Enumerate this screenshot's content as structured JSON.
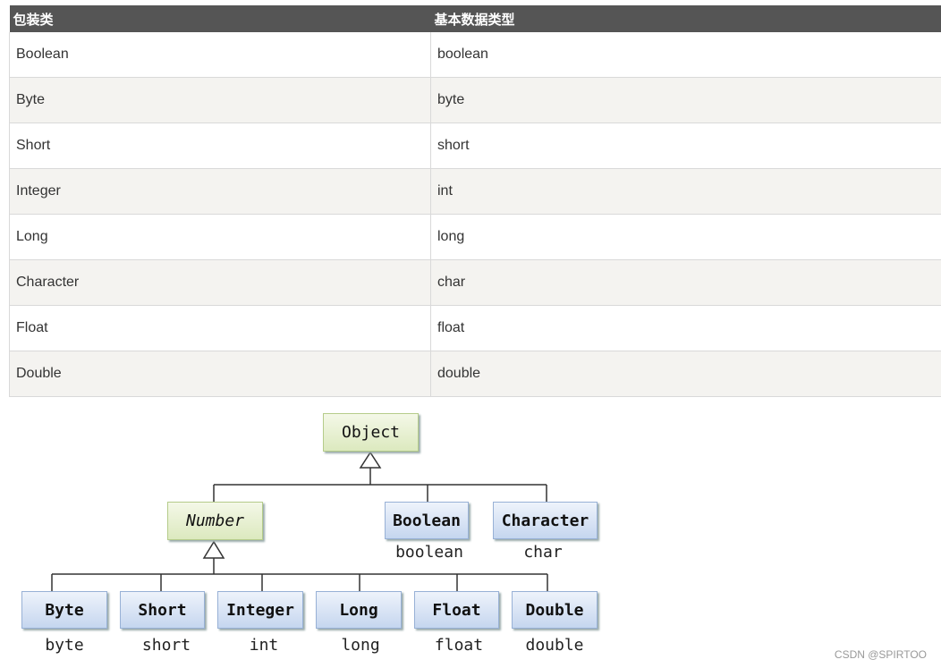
{
  "table": {
    "headers": [
      "包装类",
      "基本数据类型"
    ],
    "rows": [
      [
        "Boolean",
        "boolean"
      ],
      [
        "Byte",
        "byte"
      ],
      [
        "Short",
        "short"
      ],
      [
        "Integer",
        "int"
      ],
      [
        "Long",
        "long"
      ],
      [
        "Character",
        "char"
      ],
      [
        "Float",
        "float"
      ],
      [
        "Double",
        "double"
      ]
    ]
  },
  "diagram": {
    "root": "Object",
    "abstract": "Number",
    "direct_children": [
      {
        "class": "Boolean",
        "primitive": "boolean"
      },
      {
        "class": "Character",
        "primitive": "char"
      }
    ],
    "number_children": [
      {
        "class": "Byte",
        "primitive": "byte"
      },
      {
        "class": "Short",
        "primitive": "short"
      },
      {
        "class": "Integer",
        "primitive": "int"
      },
      {
        "class": "Long",
        "primitive": "long"
      },
      {
        "class": "Float",
        "primitive": "float"
      },
      {
        "class": "Double",
        "primitive": "double"
      }
    ]
  },
  "watermark": "CSDN @SPIRTOO"
}
